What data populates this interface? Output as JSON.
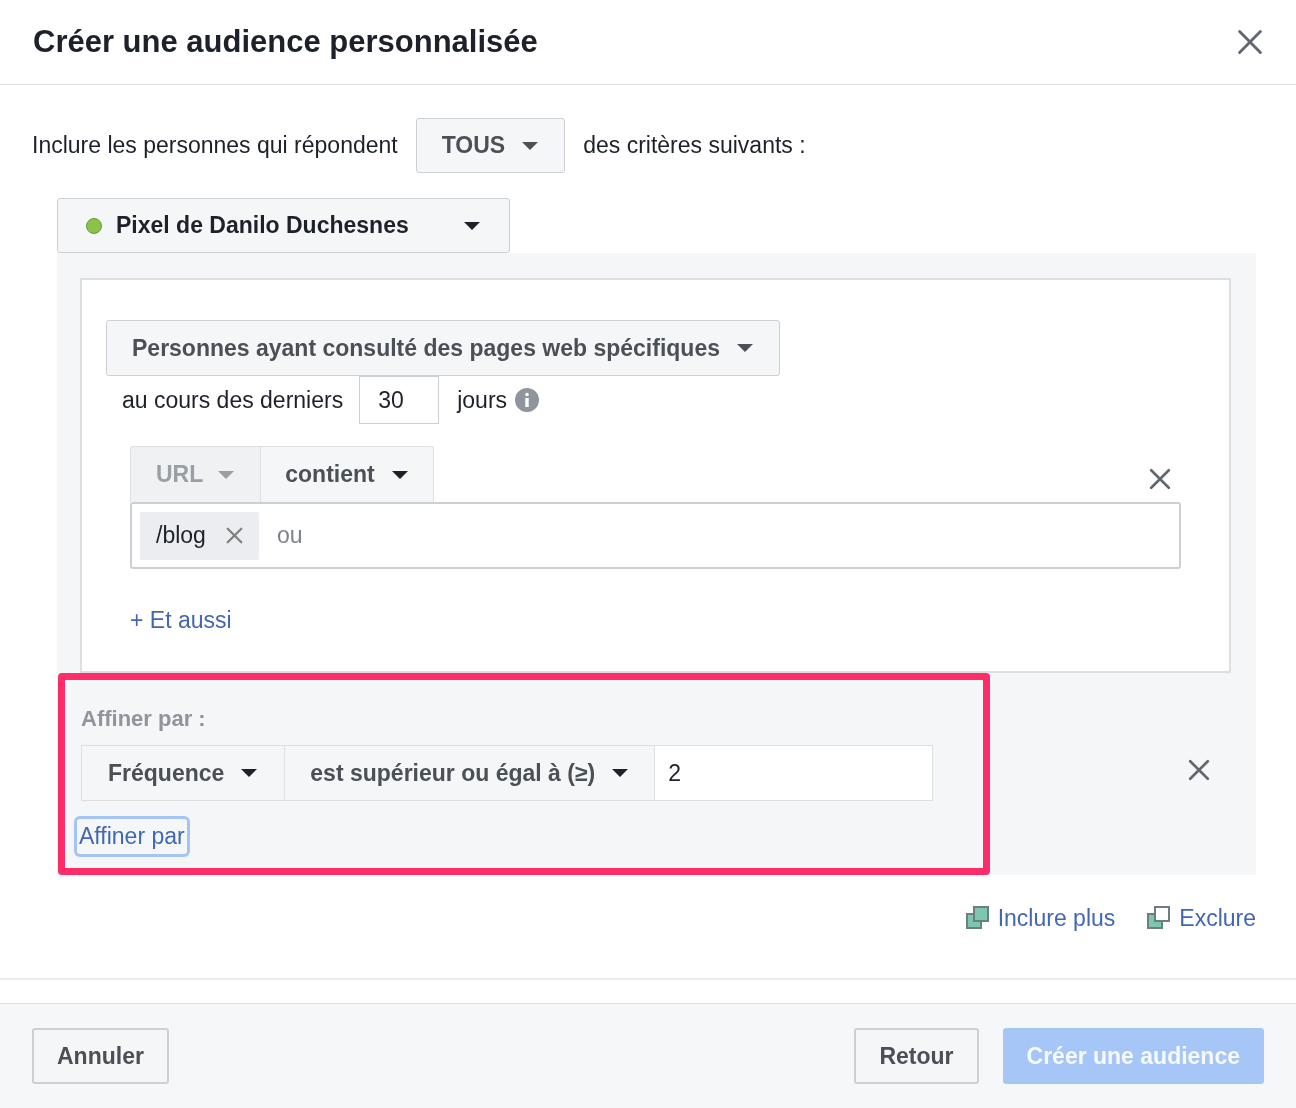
{
  "dialog": {
    "title": "Créer une audience personnalisée"
  },
  "rule": {
    "prefix": "Inclure les personnes qui répondent",
    "match": "TOUS",
    "suffix": "des critères suivants :"
  },
  "source": {
    "label": "Pixel de Danilo Duchesnes",
    "active": true
  },
  "event": "Personnes ayant consulté des pages web spécifiques",
  "retention": {
    "prefix": "au cours des derniers",
    "days": "30",
    "suffix": "jours"
  },
  "url_rule": {
    "field": {
      "label": "URL",
      "disabled": true
    },
    "operator": "contient",
    "tags": [
      "/blog"
    ],
    "placeholder": "ou"
  },
  "add_link": "+ Et aussi",
  "refine": {
    "label": "Affiner par :",
    "parameter": "Fréquence",
    "operator": "est supérieur ou égal à (≥)",
    "value": "2",
    "link": "Affiner par",
    "link_focused": true,
    "highlighted": true
  },
  "actions": [
    {
      "label": "Inclure plus",
      "kind": "include"
    },
    {
      "label": "Exclure",
      "kind": "exclude"
    }
  ],
  "footer": {
    "buttons": [
      {
        "label": "Annuler",
        "kind": "secondary",
        "disabled": false
      },
      {
        "label": "Retour",
        "kind": "secondary",
        "disabled": false
      },
      {
        "label": "Créer une audience",
        "kind": "primary",
        "disabled": true
      }
    ]
  }
}
